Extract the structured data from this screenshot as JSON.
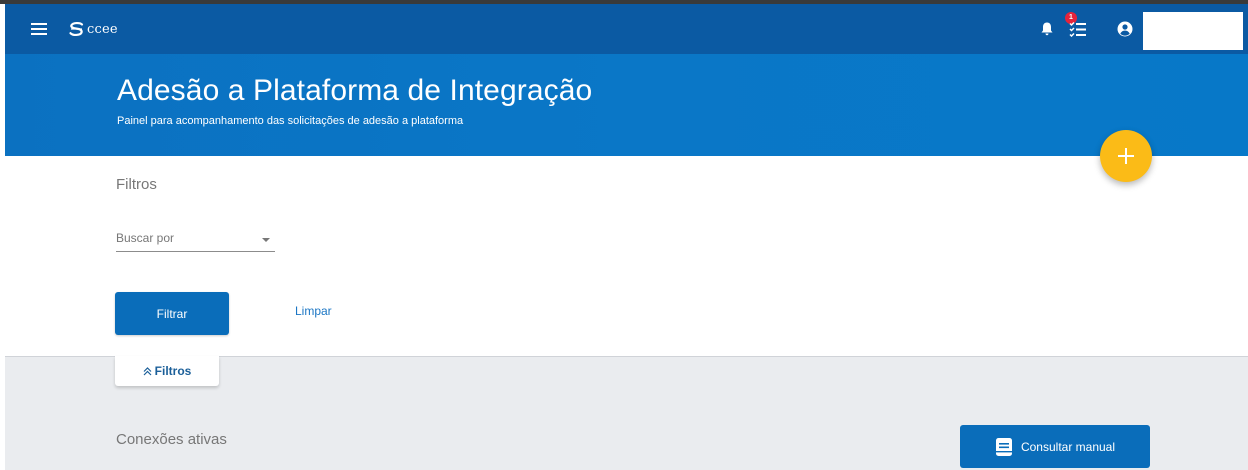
{
  "app": {
    "brand": "ccee"
  },
  "header": {
    "notification_count": "1"
  },
  "hero": {
    "title": "Adesão a Plataforma de Integração",
    "subtitle": "Painel para acompanhamento das solicitações de adesão a plataforma"
  },
  "filters": {
    "title": "Filtros",
    "search_placeholder": "Buscar por",
    "filter_button": "Filtrar",
    "clear_button": "Limpar",
    "toggle_label": "Filtros"
  },
  "connections": {
    "title": "Conexões ativas",
    "manual_button": "Consultar manual"
  },
  "colors": {
    "navbar": "#0b5aa3",
    "hero": "#0a77c7",
    "primary_button": "#0a6dba",
    "fab": "#fbbb17",
    "badge": "#e5233b",
    "panel_gray": "#eaecef"
  },
  "icons": [
    "menu-icon",
    "ccee-logo-icon",
    "bell-icon",
    "task-list-icon",
    "user-circle-icon",
    "plus-icon",
    "chevron-up-double-icon",
    "book-icon"
  ]
}
